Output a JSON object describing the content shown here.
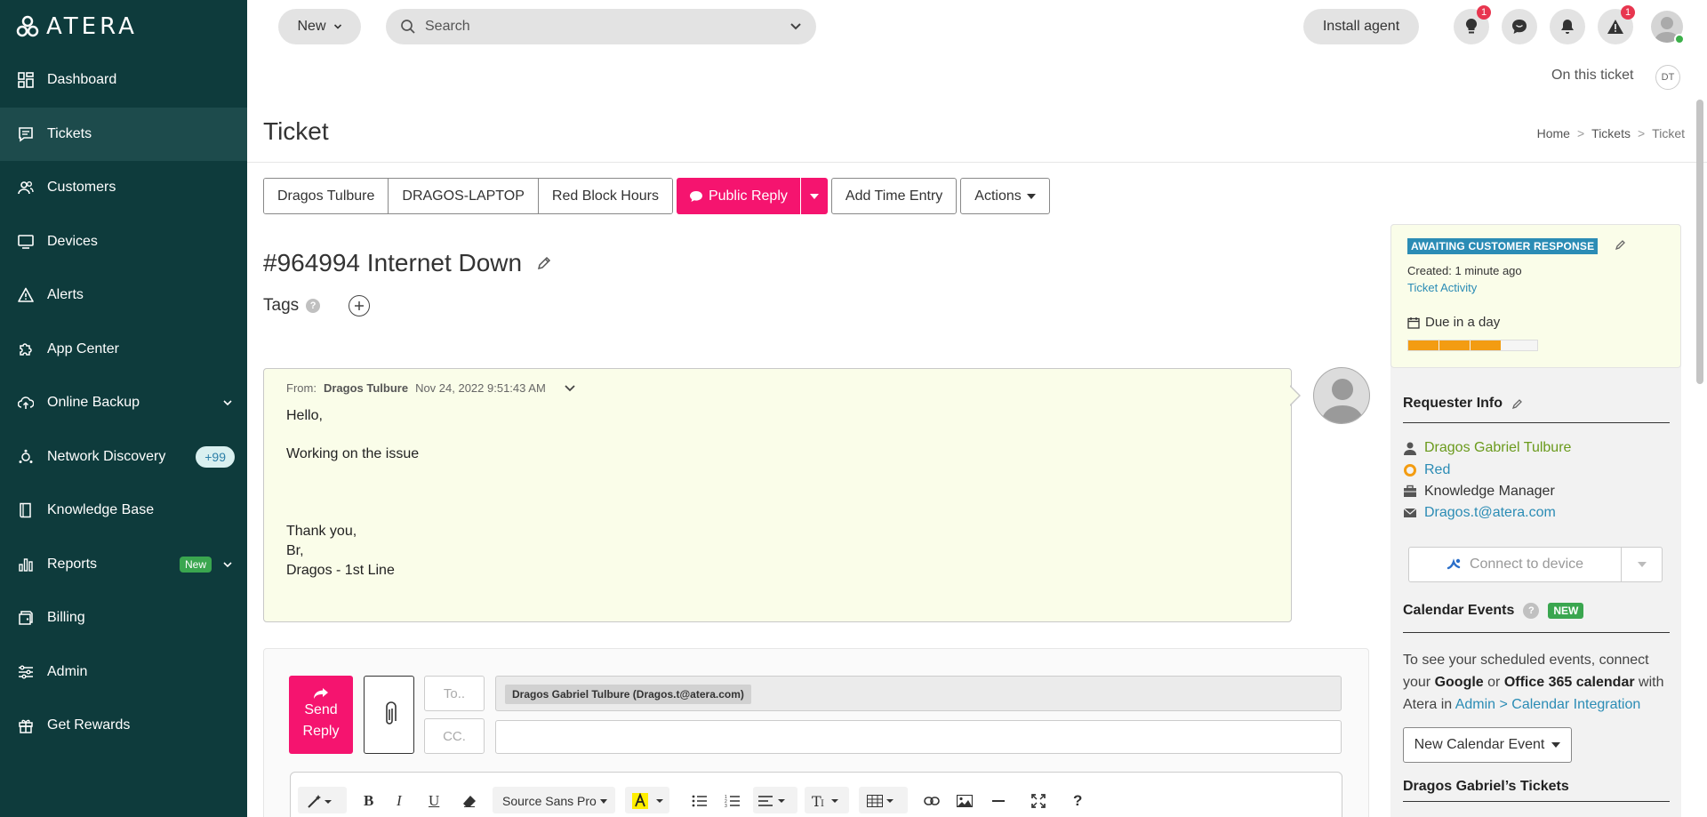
{
  "app": {
    "logo_text": "ATERA"
  },
  "sidebar": {
    "items": [
      {
        "label": "Dashboard",
        "icon": "dashboard-icon"
      },
      {
        "label": "Tickets",
        "icon": "ticket-icon",
        "active": true
      },
      {
        "label": "Customers",
        "icon": "customers-icon"
      },
      {
        "label": "Devices",
        "icon": "devices-icon"
      },
      {
        "label": "Alerts",
        "icon": "alert-icon"
      },
      {
        "label": "App Center",
        "icon": "puzzle-icon"
      },
      {
        "label": "Online Backup",
        "icon": "cloud-backup-icon",
        "chevron": true
      },
      {
        "label": "Network Discovery",
        "icon": "network-icon",
        "badge": "+99"
      },
      {
        "label": "Knowledge Base",
        "icon": "book-icon"
      },
      {
        "label": "Reports",
        "icon": "reports-icon",
        "new_badge": "New",
        "chevron": true
      },
      {
        "label": "Billing",
        "icon": "billing-icon"
      },
      {
        "label": "Admin",
        "icon": "sliders-icon"
      },
      {
        "label": "Get Rewards",
        "icon": "gift-icon"
      }
    ]
  },
  "topbar": {
    "new_label": "New",
    "search_placeholder": "Search",
    "install_label": "Install agent",
    "lightbulb_badge": "1",
    "alerts_badge": "1"
  },
  "page": {
    "on_ticket_label": "On this ticket",
    "viewer_initials": "DT",
    "title": "Ticket",
    "breadcrumb": [
      "Home",
      "Tickets",
      "Ticket"
    ]
  },
  "buttons": {
    "customer": "Dragos Tulbure",
    "device": "DRAGOS-LAPTOP",
    "hours": "Red Block Hours",
    "public_reply": "Public Reply",
    "add_time": "Add Time Entry",
    "actions": "Actions"
  },
  "ticket": {
    "title": "#964994 Internet Down",
    "tags_label": "Tags"
  },
  "message": {
    "from_label": "From:",
    "from_name": "Dragos Tulbure",
    "date": "Nov 24, 2022 9:51:43 AM",
    "body": [
      "Hello,",
      "Working on the issue",
      "Thank you,",
      "Br,",
      "Dragos - 1st Line"
    ]
  },
  "reply": {
    "send_label_1": "Send",
    "send_label_2": "Reply",
    "to_placeholder": "To..",
    "cc_placeholder": "CC.",
    "recipient": "Dragos Gabriel Tulbure (Dragos.t@atera.com)",
    "font_name": "Source Sans Pro",
    "help": "?"
  },
  "status": {
    "badge": "AWAITING CUSTOMER RESPONSE",
    "created": "Created: 1 minute ago",
    "activity_link": "Ticket Activity",
    "due": "Due in a day",
    "due_progress": 0.6,
    "accent": "#f39c12"
  },
  "requester": {
    "title": "Requester Info",
    "name": "Dragos Gabriel Tulbure",
    "customer": "Red",
    "role": "Knowledge Manager",
    "email": "Dragos.t@atera.com",
    "connect_label": "Connect to device"
  },
  "calendar": {
    "title": "Calendar Events",
    "new_tag": "NEW",
    "text_1": "To see your scheduled events, connect your",
    "google": "Google",
    "or": "or",
    "office": "Office 365 calendar",
    "text_2": "with Atera in",
    "link": "Admin > Calendar Integration",
    "new_event": "New Calendar Event"
  },
  "tickets_section": {
    "title": "Dragos Gabriel’s Tickets"
  },
  "colors": {
    "sidebar_bg": "#0e3b3c",
    "accent_pink": "#f5146f",
    "link_blue": "#2b8cb5",
    "status_blue": "#2b8cb5"
  }
}
